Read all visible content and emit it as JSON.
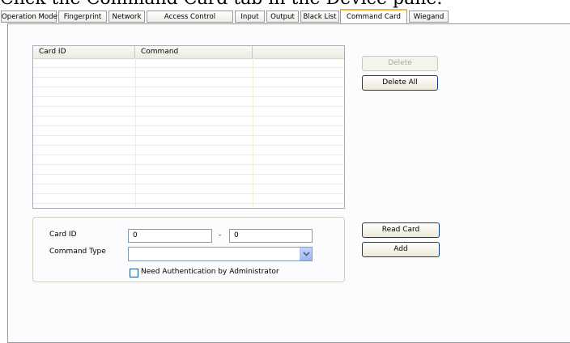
{
  "caption": "Click the Command Card tab in the Device pane.",
  "tabs": [
    {
      "label": "Operation Mode",
      "active": false
    },
    {
      "label": "Fingerprint",
      "active": false
    },
    {
      "label": "Network",
      "active": false
    },
    {
      "label": "Access Control",
      "active": false
    },
    {
      "label": "Input",
      "active": false
    },
    {
      "label": "Output",
      "active": false
    },
    {
      "label": "Black List",
      "active": false
    },
    {
      "label": "Command Card",
      "active": true
    },
    {
      "label": "Wiegand",
      "active": false
    }
  ],
  "list": {
    "columns": [
      "Card ID",
      "Command",
      ""
    ],
    "rows": []
  },
  "buttons": {
    "delete": "Delete",
    "delete_all": "Delete All",
    "read_card": "Read Card",
    "add": "Add"
  },
  "form": {
    "card_id_label": "Card ID",
    "card_id_from": "0",
    "range_separator": "-",
    "card_id_to": "0",
    "command_type_label": "Command Type",
    "command_type_value": "",
    "need_auth_label": "Need Authentication by Administrator",
    "need_auth_checked": false
  },
  "icons": {
    "combo_arrow": "chevron-down-icon"
  }
}
